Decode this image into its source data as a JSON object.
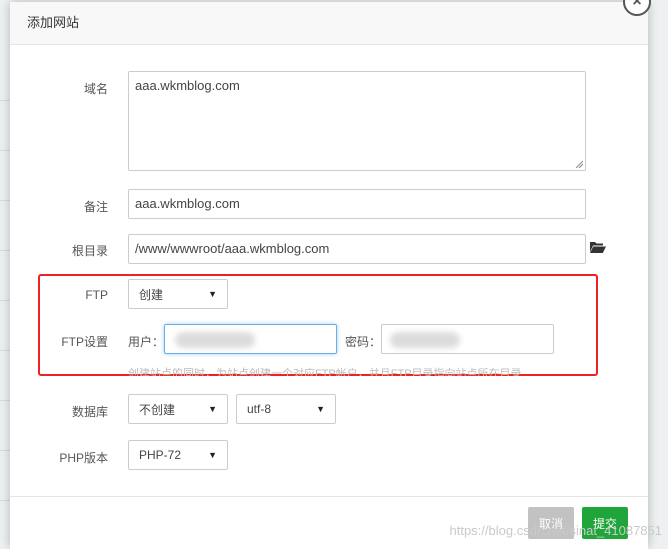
{
  "dialog": {
    "title": "添加网站",
    "close_glyph": "×"
  },
  "form": {
    "domain": {
      "label": "域名",
      "value": "aaa.wkmblog.com"
    },
    "remark": {
      "label": "备注",
      "value": "aaa.wkmblog.com"
    },
    "root_dir": {
      "label": "根目录",
      "value": "/www/wwwroot/aaa.wkmblog.com",
      "icon": "folder-open-icon"
    },
    "ftp": {
      "label": "FTP",
      "selected": "创建"
    },
    "ftp_settings": {
      "label": "FTP设置",
      "user_label": "用户：",
      "password_label": "密码：",
      "hint": "创建站点的同时，为站点创建一个对应FTP帐户，并且FTP目录指向站点所在目录"
    },
    "database": {
      "label": "数据库",
      "selected": "不创建",
      "charset_selected": "utf-8"
    },
    "php": {
      "label": "PHP版本",
      "selected": "PHP-72"
    }
  },
  "footer": {
    "cancel_label": "取消",
    "submit_label": "提交"
  },
  "watermark": "https://blog.csdn.net/sinat_41087851",
  "colors": {
    "submit_green": "#20a53a",
    "cancel_gray": "#c2c2c2",
    "highlight_red": "#ee2222",
    "focus_blue": "#66afe9"
  }
}
